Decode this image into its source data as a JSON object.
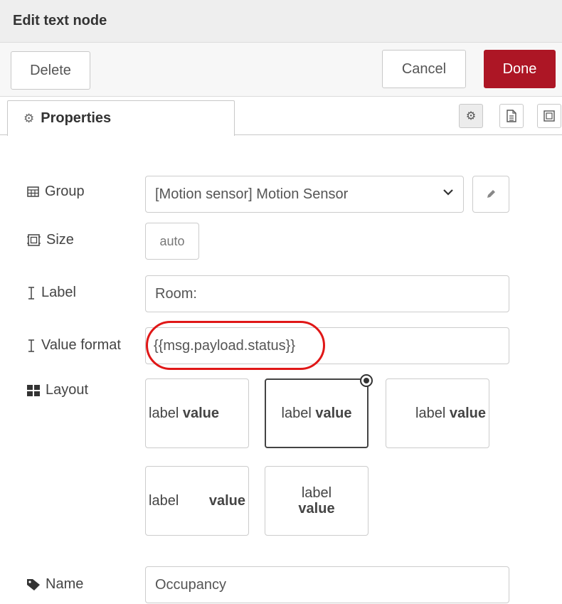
{
  "window": {
    "title": "Edit text node"
  },
  "toolbar": {
    "delete_label": "Delete",
    "cancel_label": "Cancel",
    "done_label": "Done",
    "done_color": "#ad1625"
  },
  "tabs": {
    "properties_label": "Properties"
  },
  "form": {
    "group": {
      "label": "Group",
      "value": "[Motion sensor] Motion Sensor"
    },
    "size": {
      "label": "Size",
      "value": "auto"
    },
    "label_field": {
      "label": "Label",
      "value": "Room:"
    },
    "value_format": {
      "label": "Value format",
      "value": "{{msg.payload.status}}"
    },
    "layout": {
      "label": "Layout",
      "selected_index": 1,
      "options": [
        {
          "label": "label",
          "value": "value"
        },
        {
          "label": "label",
          "value": "value"
        },
        {
          "label": "label",
          "value": "value"
        },
        {
          "label": "label",
          "value": "value"
        },
        {
          "label": "label",
          "value": "value"
        }
      ]
    },
    "name": {
      "label": "Name",
      "value": "Occupancy"
    }
  },
  "icons": [
    "gear-icon",
    "document-icon",
    "frame-icon",
    "table-icon",
    "size-icon",
    "text-cursor-icon",
    "grid-icon",
    "tag-icon",
    "pencil-icon",
    "chevron-down-icon"
  ],
  "annotation": {
    "highlight_color": "#e01717"
  }
}
